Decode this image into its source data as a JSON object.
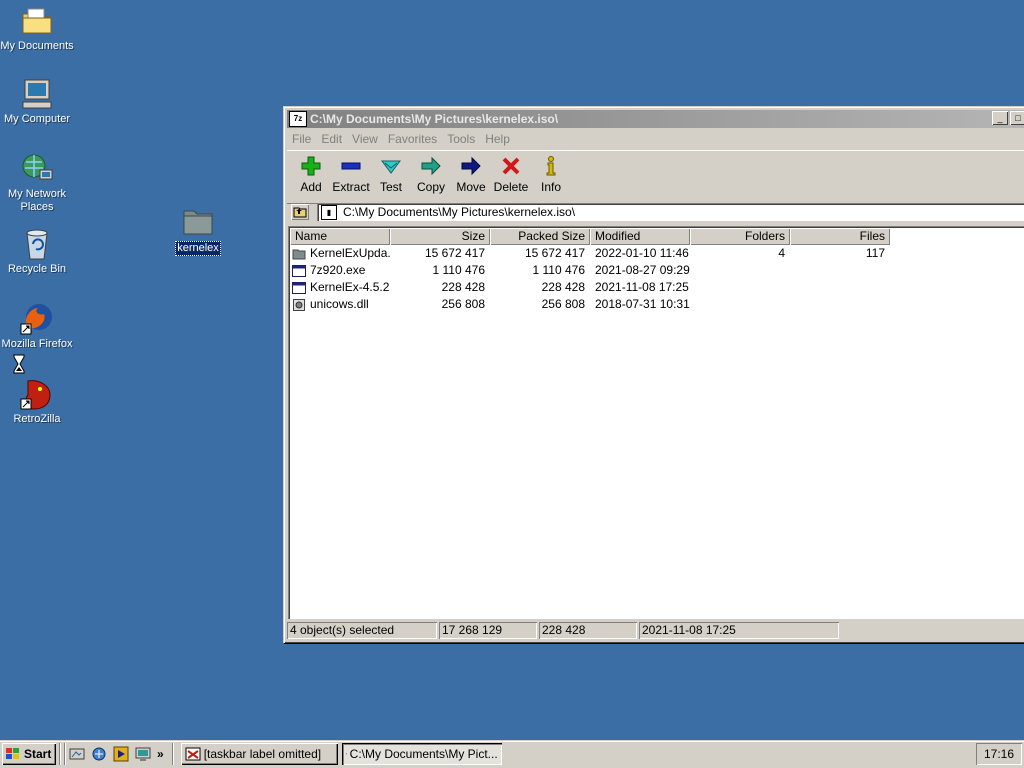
{
  "desktop": {
    "icons": [
      {
        "label": "My Documents",
        "icon": "folder-documents-icon"
      },
      {
        "label": "My Computer",
        "icon": "computer-icon"
      },
      {
        "label": "My Network\nPlaces",
        "icon": "network-icon"
      },
      {
        "label": "Recycle Bin",
        "icon": "recycle-bin-icon"
      },
      {
        "label": "Mozilla Firefox",
        "icon": "firefox-icon"
      },
      {
        "label": "RetroZilla",
        "icon": "retrozilla-icon"
      },
      {
        "label": "kernelex",
        "icon": "folder-icon"
      }
    ]
  },
  "window": {
    "title": "C:\\My Documents\\My Pictures\\kernelex.iso\\",
    "app_icon": "7z",
    "controls": {
      "minimize": "_",
      "maximize": "□"
    },
    "menu": [
      "File",
      "Edit",
      "View",
      "Favorites",
      "Tools",
      "Help"
    ],
    "toolbar": [
      {
        "label": "Add",
        "icon": "add-icon",
        "color": "#18a018"
      },
      {
        "label": "Extract",
        "icon": "extract-icon",
        "color": "#1830a8"
      },
      {
        "label": "Test",
        "icon": "test-icon",
        "color": "#20a0a0"
      },
      {
        "label": "Copy",
        "icon": "copy-icon",
        "color": "#208878"
      },
      {
        "label": "Move",
        "icon": "move-icon",
        "color": "#101880"
      },
      {
        "label": "Delete",
        "icon": "delete-icon",
        "color": "#d01818"
      },
      {
        "label": "Info",
        "icon": "info-icon",
        "color": "#c8a800"
      }
    ],
    "address": "C:\\My Documents\\My Pictures\\kernelex.iso\\",
    "columns": [
      "Name",
      "Size",
      "Packed Size",
      "Modified",
      "Folders",
      "Files"
    ],
    "rows": [
      {
        "icon": "folder-icon",
        "name": "KernelExUpda...",
        "size": "15 672 417",
        "packed": "15 672 417",
        "modified": "2022-01-10 11:46",
        "folders": "4",
        "files": "117"
      },
      {
        "icon": "exe-icon",
        "name": "7z920.exe",
        "size": "1 110 476",
        "packed": "1 110 476",
        "modified": "2021-08-27 09:29",
        "folders": "",
        "files": ""
      },
      {
        "icon": "exe-icon",
        "name": "KernelEx-4.5.2...",
        "size": "228 428",
        "packed": "228 428",
        "modified": "2021-11-08 17:25",
        "folders": "",
        "files": ""
      },
      {
        "icon": "dll-icon",
        "name": "unicows.dll",
        "size": "256 808",
        "packed": "256 808",
        "modified": "2018-07-31 10:31",
        "folders": "",
        "files": ""
      }
    ],
    "status": [
      "4 object(s) selected",
      "17 268 129",
      "228 428",
      "2021-11-08 17:25"
    ]
  },
  "taskbar": {
    "start_label": "Start",
    "quicklaunch_more": "»",
    "tasks": [
      {
        "label": "[taskbar label omitted]",
        "active": false
      },
      {
        "label": "C:\\My Documents\\My Pict...",
        "active": true
      }
    ],
    "clock": "17:16"
  }
}
